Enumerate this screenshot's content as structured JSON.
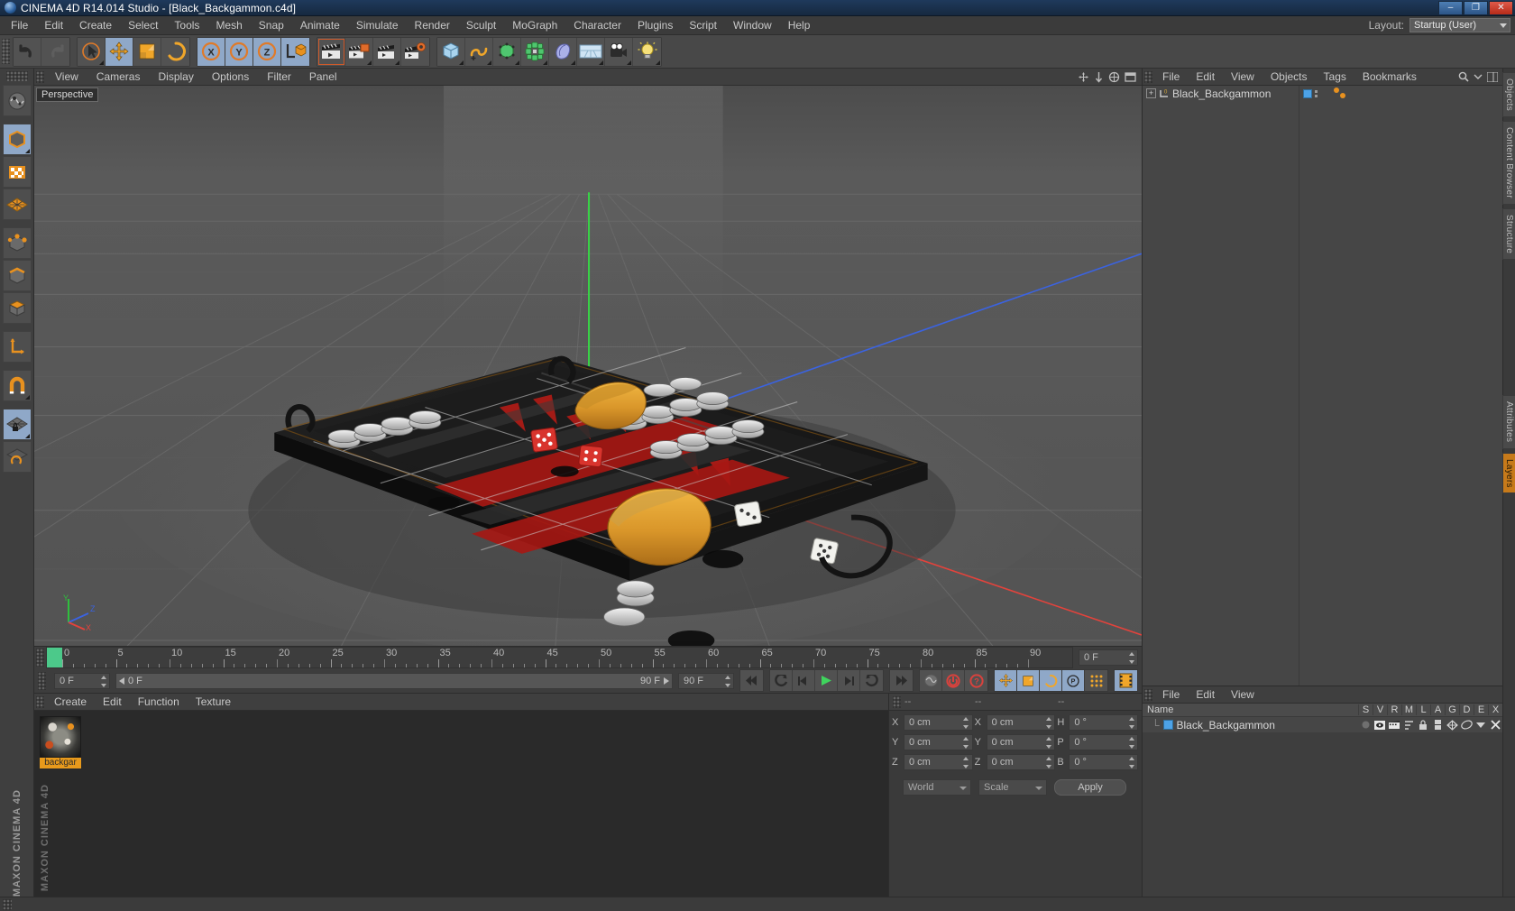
{
  "window": {
    "title": "CINEMA 4D R14.014 Studio - [Black_Backgammon.c4d]",
    "logo": "c4d-logo",
    "buttons": {
      "minimize": "–",
      "maximize": "❐",
      "close": "✕"
    }
  },
  "menubar": {
    "items": [
      "File",
      "Edit",
      "Create",
      "Select",
      "Tools",
      "Mesh",
      "Snap",
      "Animate",
      "Simulate",
      "Render",
      "Sculpt",
      "MoGraph",
      "Character",
      "Plugins",
      "Script",
      "Window",
      "Help"
    ],
    "layout_label": "Layout:",
    "layout_value": "Startup (User)"
  },
  "toolbar": {
    "groups": [
      {
        "name": "undo-redo",
        "buttons": [
          {
            "name": "undo-button",
            "icon": "undo-arrow-icon"
          },
          {
            "name": "redo-button",
            "icon": "redo-arrow-icon"
          }
        ]
      },
      {
        "name": "transform-tools",
        "buttons": [
          {
            "name": "live-selection-button",
            "icon": "cursor-selection-icon"
          },
          {
            "name": "move-button",
            "icon": "move-cross-icon"
          },
          {
            "name": "scale-button",
            "icon": "scale-square-icon"
          },
          {
            "name": "rotate-button",
            "icon": "rotate-circle-icon"
          }
        ]
      },
      {
        "name": "axis-lock",
        "buttons": [
          {
            "name": "x-axis-button",
            "icon": "x-axis-icon"
          },
          {
            "name": "y-axis-button",
            "icon": "y-axis-icon"
          },
          {
            "name": "z-axis-button",
            "icon": "z-axis-icon"
          },
          {
            "name": "world-object-coordinate-button",
            "icon": "world-coordinate-icon"
          }
        ]
      },
      {
        "name": "render-tools",
        "buttons": [
          {
            "name": "render-view-button",
            "icon": "clapperboard-icon"
          },
          {
            "name": "render-region-button",
            "icon": "clapperboard-region-icon"
          },
          {
            "name": "render-queue-button",
            "icon": "clapperboard-queue-icon"
          },
          {
            "name": "render-settings-button",
            "icon": "clapperboard-gear-icon"
          }
        ]
      },
      {
        "name": "object-creation",
        "buttons": [
          {
            "name": "add-cube-button",
            "icon": "cube-icon"
          },
          {
            "name": "add-spline-button",
            "icon": "spline-icon"
          },
          {
            "name": "add-generator-button",
            "icon": "generator-cube-icon"
          },
          {
            "name": "add-deformer-button",
            "icon": "deformer-icon"
          },
          {
            "name": "add-scene-object-button",
            "icon": "environment-icon"
          },
          {
            "name": "add-floor-button",
            "icon": "floor-grid-icon"
          },
          {
            "name": "add-camera-button",
            "icon": "camera-icon"
          },
          {
            "name": "add-light-button",
            "icon": "light-bulb-icon"
          }
        ]
      }
    ]
  },
  "left_palette": {
    "items": [
      {
        "name": "make-editable-button",
        "icon": "editable-mesh-icon"
      },
      {
        "name": "model-mode-button",
        "icon": "model-cube-icon",
        "selected": true
      },
      {
        "name": "texture-mode-button",
        "icon": "texture-checker-icon"
      },
      {
        "name": "workplane-mode-button",
        "icon": "workplane-grid-icon"
      },
      {
        "name": "points-mode-button",
        "icon": "points-cube-icon"
      },
      {
        "name": "edges-mode-button",
        "icon": "edges-cube-icon"
      },
      {
        "name": "polygons-mode-button",
        "icon": "polygons-cube-icon"
      },
      {
        "name": "axis-mode-button",
        "icon": "axis-l-icon"
      },
      {
        "name": "enable-snap-button",
        "icon": "magnet-icon"
      },
      {
        "name": "lock-workplane-button",
        "icon": "workplane-lock-icon",
        "selected": true
      },
      {
        "name": "planar-workplane-button",
        "icon": "workplane-rotate-icon"
      }
    ],
    "brand": "MAXON CINEMA 4D"
  },
  "viewport": {
    "menu": [
      "View",
      "Cameras",
      "Display",
      "Options",
      "Filter",
      "Panel"
    ],
    "label": "Perspective",
    "axis_gizmo": {
      "x": "X",
      "y": "Y",
      "z": "Z"
    },
    "corner_icons": [
      "move-view-icon",
      "pan-view-icon",
      "zoom-view-icon",
      "rotate-view-icon",
      "maximize-view-icon"
    ],
    "scene_description": "3D backgammon board with checkers, dice and leather case"
  },
  "timeline": {
    "ruler": {
      "labels": [
        "0",
        "5",
        "10",
        "15",
        "20",
        "25",
        "30",
        "35",
        "40",
        "45",
        "50",
        "55",
        "60",
        "65",
        "70",
        "75",
        "80",
        "85",
        "90"
      ],
      "min": 0,
      "max": 90,
      "current_frame_marker": 0
    },
    "current_frame_field": "0 F",
    "start_field": "0 F",
    "range_start": "0 F",
    "range_end": "90 F",
    "end_field": "90 F",
    "buttons": [
      {
        "name": "go-to-start-button",
        "icon": "skip-start-icon"
      },
      {
        "name": "previous-key-button",
        "icon": "previous-key-icon"
      },
      {
        "name": "previous-frame-button",
        "icon": "step-back-icon"
      },
      {
        "name": "play-button",
        "icon": "play-icon"
      },
      {
        "name": "next-frame-button",
        "icon": "step-forward-icon"
      },
      {
        "name": "next-key-button",
        "icon": "next-key-icon"
      },
      {
        "name": "go-to-end-button",
        "icon": "skip-end-icon"
      },
      {
        "name": "record-active-objects-button",
        "icon": "record-ghost-icon"
      },
      {
        "name": "autokeying-button",
        "icon": "autokey-icon"
      },
      {
        "name": "keyframe-selection-button",
        "icon": "keyframe-question-icon"
      },
      {
        "name": "position-key-button",
        "icon": "move-cross-icon",
        "selected": true
      },
      {
        "name": "scale-key-button",
        "icon": "scale-square-icon",
        "selected": true
      },
      {
        "name": "rotation-key-button",
        "icon": "rotate-circle-icon",
        "selected": true
      },
      {
        "name": "parameter-key-button",
        "icon": "parameter-p-icon",
        "selected": true
      },
      {
        "name": "point-level-animation-button",
        "icon": "pla-dots-icon"
      },
      {
        "name": "timeline-window-button",
        "icon": "filmstrip-icon",
        "selected": true
      }
    ]
  },
  "material_manager": {
    "menu": [
      "Create",
      "Edit",
      "Function",
      "Texture"
    ],
    "materials": [
      {
        "name": "backgar",
        "thumb": "marble-sphere-thumb"
      }
    ],
    "watermark": "MAXON CINEMA 4D"
  },
  "coordinates": {
    "headers": [
      "--",
      "--",
      "--"
    ],
    "rows": [
      {
        "pos_label": "X",
        "pos_value": "0 cm",
        "size_label": "X",
        "size_value": "0 cm",
        "rot_label": "H",
        "rot_value": "0 °"
      },
      {
        "pos_label": "Y",
        "pos_value": "0 cm",
        "size_label": "Y",
        "size_value": "0 cm",
        "rot_label": "P",
        "rot_value": "0 °"
      },
      {
        "pos_label": "Z",
        "pos_value": "0 cm",
        "size_label": "Z",
        "size_value": "0 cm",
        "rot_label": "B",
        "rot_value": "0 °"
      }
    ],
    "system_select": "World",
    "mode_select": "Scale",
    "apply_label": "Apply"
  },
  "object_manager": {
    "menu": [
      "File",
      "Edit",
      "View",
      "Objects",
      "Tags",
      "Bookmarks"
    ],
    "search_icon": "search-icon",
    "objects": [
      {
        "name": "Black_Backgammon",
        "icon": "null-object-icon",
        "layer_color": "#4da3e8"
      }
    ]
  },
  "layer_manager": {
    "menu": [
      "File",
      "Edit",
      "View"
    ],
    "columns": [
      "Name",
      "S",
      "V",
      "R",
      "M",
      "L",
      "A",
      "G",
      "D",
      "E",
      "X"
    ],
    "rows": [
      {
        "name": "Black_Backgammon",
        "color": "#4da3e8"
      }
    ]
  },
  "right_tabs": [
    "Objects",
    "Content Browser",
    "Structure",
    "Attributes",
    "Layers"
  ],
  "colors": {
    "accent_orange": "#e8911f",
    "selection_blue": "#8fa8c8",
    "panel_bg": "#3a3a3a",
    "viewport_bg": "#555555",
    "title_blue": "#1f3a5c",
    "timeline_green": "#4cc98a"
  }
}
